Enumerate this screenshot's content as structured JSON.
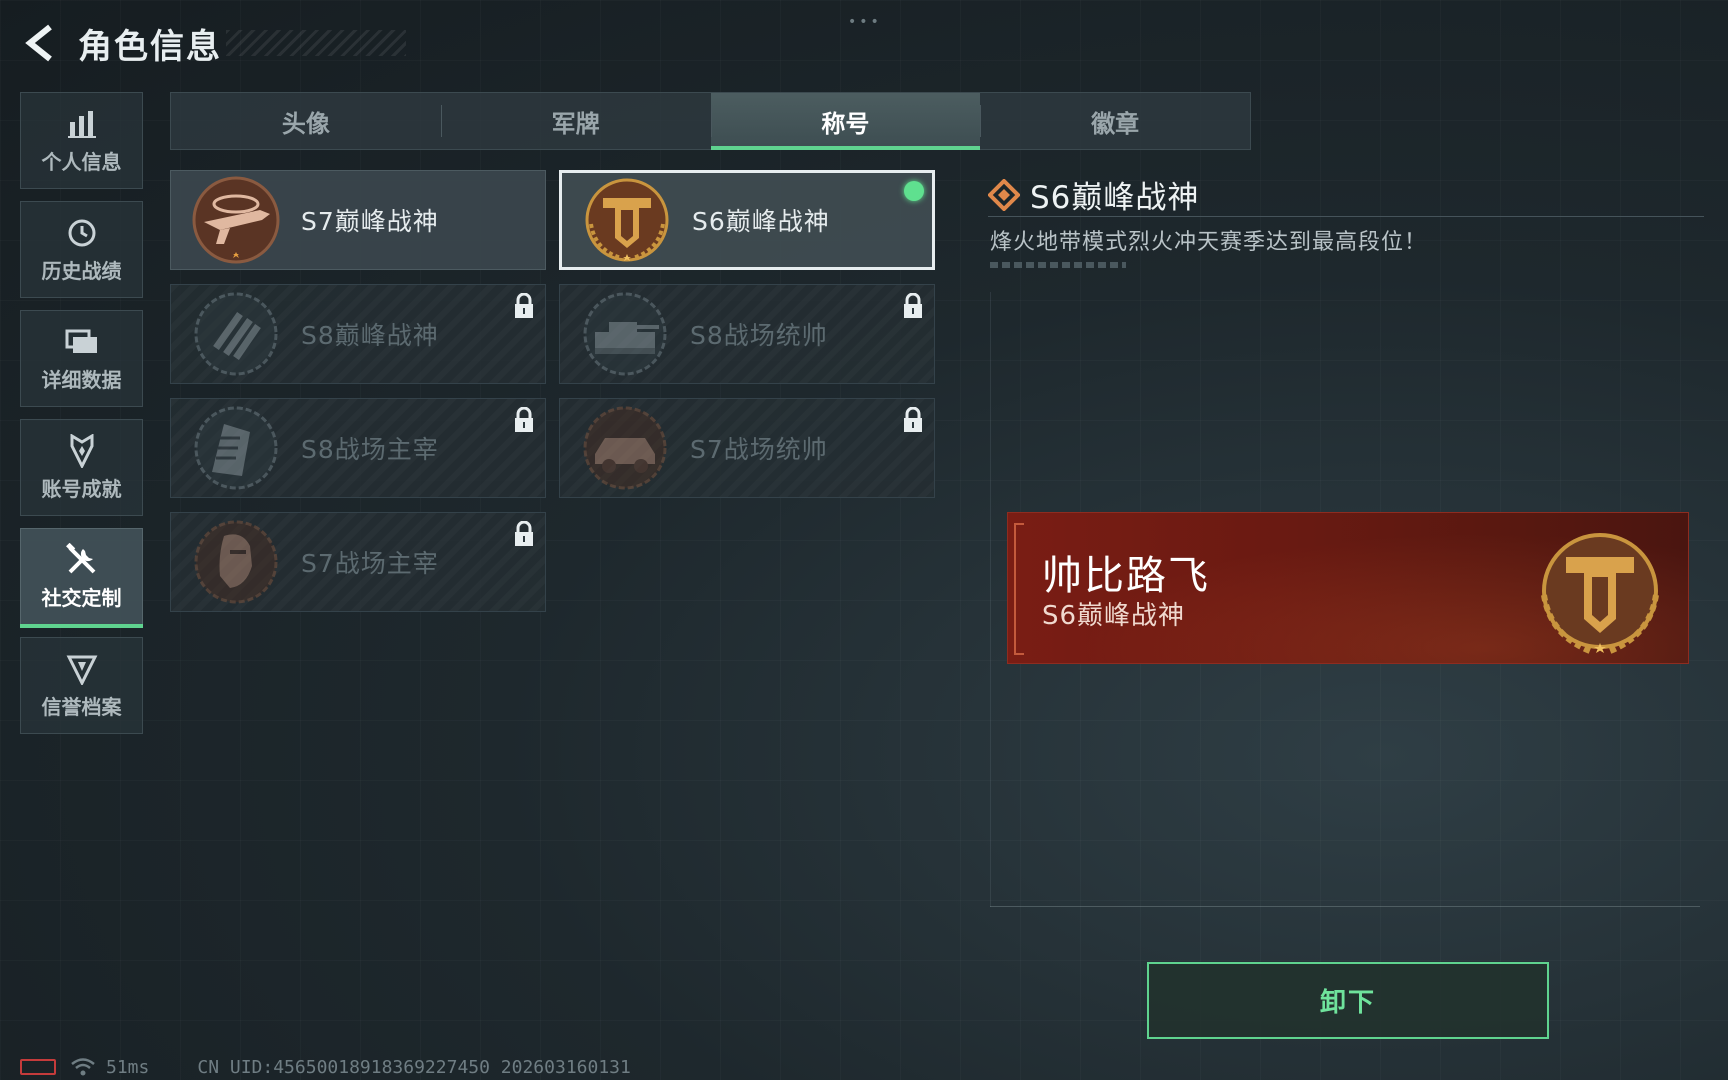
{
  "header": {
    "title": "角色信息"
  },
  "sidebar": {
    "items": [
      {
        "label": "个人信息",
        "icon": "bar-chart-icon"
      },
      {
        "label": "历史战绩",
        "icon": "history-icon"
      },
      {
        "label": "详细数据",
        "icon": "folder-icon"
      },
      {
        "label": "账号成就",
        "icon": "achievement-icon"
      },
      {
        "label": "社交定制",
        "icon": "tools-icon",
        "active": true
      },
      {
        "label": "信誉档案",
        "icon": "credit-icon"
      }
    ]
  },
  "tabs": [
    {
      "label": "头像"
    },
    {
      "label": "军牌"
    },
    {
      "label": "称号",
      "active": true
    },
    {
      "label": "徽章"
    }
  ],
  "titles": [
    {
      "name": "S7巅峰战神",
      "state": "owned",
      "badge": "rifle-emblem-icon"
    },
    {
      "name": "S6巅峰战神",
      "state": "selected-equipped",
      "badge": "shield-laurel-emblem-icon"
    },
    {
      "name": "S8巅峰战神",
      "state": "locked",
      "badge": "slash-emblem-icon"
    },
    {
      "name": "S8战场统帅",
      "state": "locked",
      "badge": "tank-emblem-icon"
    },
    {
      "name": "S8战场主宰",
      "state": "locked",
      "badge": "building-emblem-icon"
    },
    {
      "name": "S7战场统帅",
      "state": "locked",
      "badge": "vehicle-emblem-icon"
    },
    {
      "name": "S7战场主宰",
      "state": "locked",
      "badge": "soldier-emblem-icon"
    }
  ],
  "detail": {
    "name": "S6巅峰战神",
    "description": "烽火地带模式烈火冲天赛季达到最高段位！"
  },
  "nameplate": {
    "player_name": "帅比路飞",
    "title": "S6巅峰战神"
  },
  "actions": {
    "unequip_label": "卸下"
  },
  "status_bar": {
    "ping": "51ms",
    "uid": "CN UID:45650018918369227450 202603160131"
  },
  "colors": {
    "accent": "#5fd38f",
    "plate_red": "#7a1d14",
    "battery_low": "#c43b3b",
    "gold": "#c9953e"
  }
}
